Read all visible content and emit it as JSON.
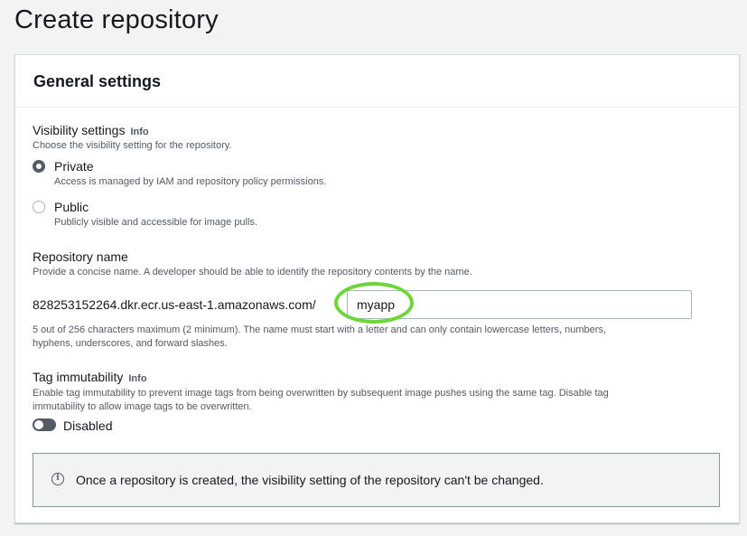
{
  "page": {
    "title": "Create repository"
  },
  "general": {
    "header": "General settings",
    "visibility": {
      "label": "Visibility settings",
      "info": "Info",
      "description": "Choose the visibility setting for the repository.",
      "options": [
        {
          "label": "Private",
          "description": "Access is managed by IAM and repository policy permissions.",
          "checked": true
        },
        {
          "label": "Public",
          "description": "Publicly visible and accessible for image pulls.",
          "checked": false
        }
      ]
    },
    "repository_name": {
      "label": "Repository name",
      "description": "Provide a concise name. A developer should be able to identify the repository contents by the name.",
      "prefix": "828253152264.dkr.ecr.us-east-1.amazonaws.com/",
      "value": "myapp",
      "help_line1": "5 out of 256 characters maximum (2 minimum). The name must start with a letter and can only contain lowercase letters, numbers,",
      "help_line2": "hyphens, underscores, and forward slashes."
    },
    "tag_immutability": {
      "label": "Tag immutability",
      "info": "Info",
      "description_line1": "Enable tag immutability to prevent image tags from being overwritten by subsequent image pushes using the same tag. Disable tag",
      "description_line2": "immutability to allow image tags to be overwritten.",
      "toggle_label": "Disabled"
    },
    "alert": {
      "icon": "info-icon",
      "text": "Once a repository is created, the visibility setting of the repository can't be changed."
    }
  },
  "colors": {
    "highlight": "#6dd63a",
    "page_bg": "#f2f3f3",
    "toggle_off": "#545b64"
  }
}
